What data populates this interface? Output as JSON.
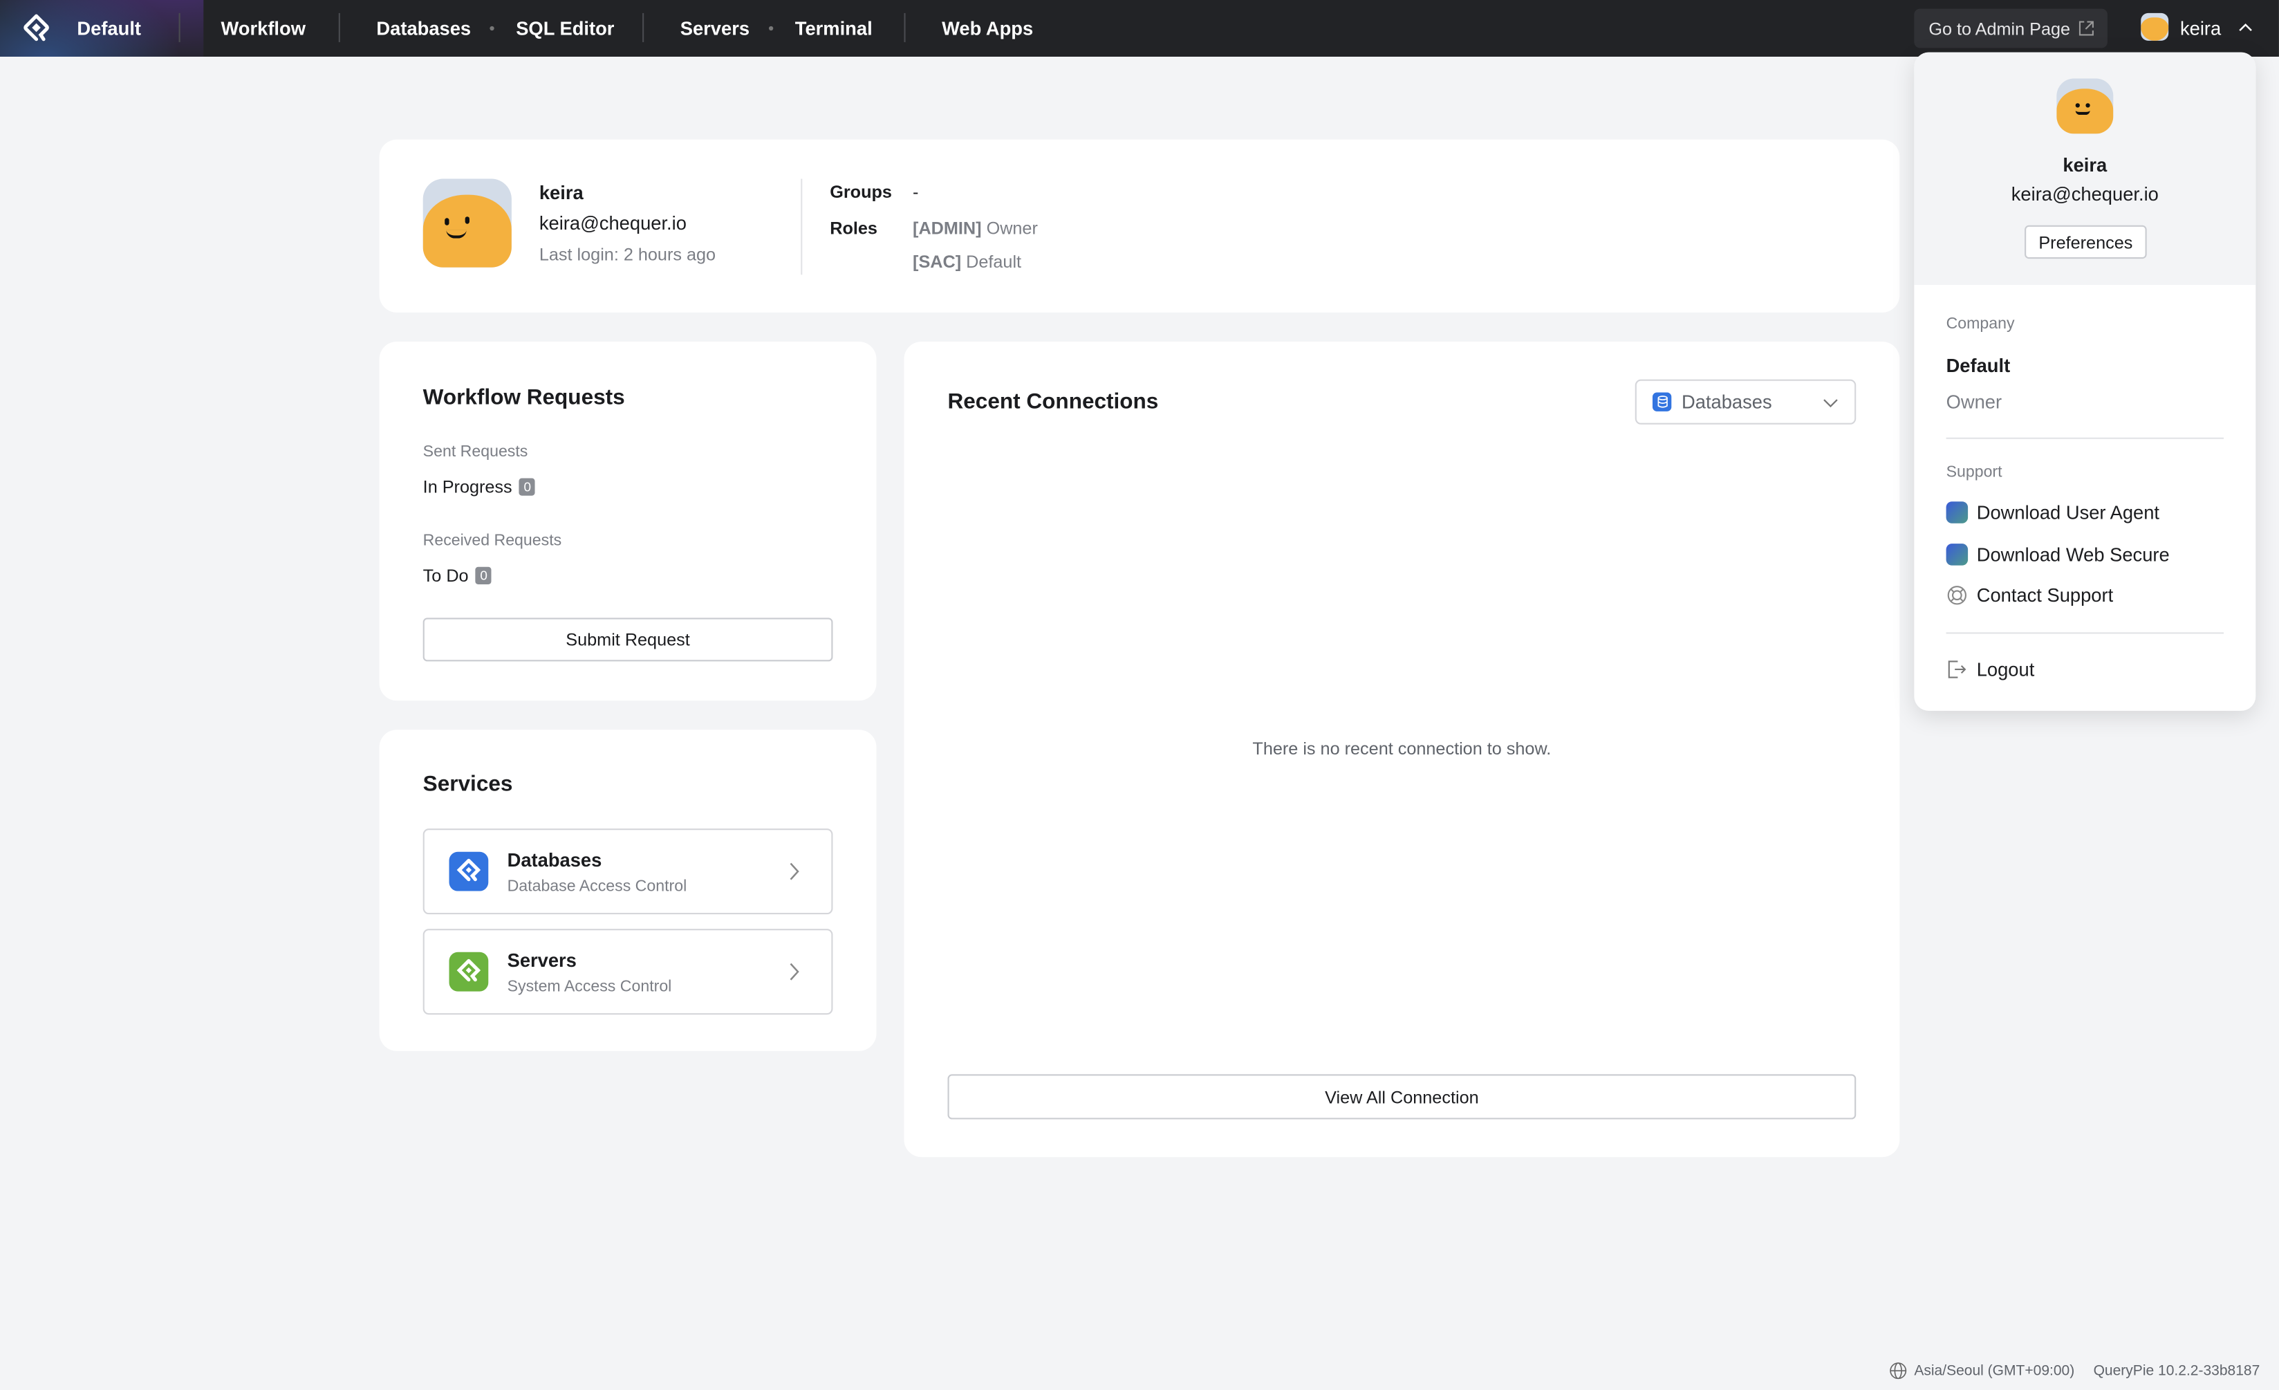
{
  "topbar": {
    "workspace": "Default",
    "nav": [
      "Workflow",
      "Databases",
      "SQL Editor",
      "Servers",
      "Terminal",
      "Web Apps"
    ],
    "admin_button": "Go to Admin Page",
    "user": "keira"
  },
  "profile": {
    "name": "keira",
    "email": "keira@chequer.io",
    "last_login": "Last login: 2 hours ago",
    "groups_label": "Groups",
    "groups_value": "-",
    "roles_label": "Roles",
    "roles": [
      {
        "tag": "[ADMIN]",
        "name": "Owner"
      },
      {
        "tag": "[SAC]",
        "name": "Default"
      }
    ]
  },
  "workflow": {
    "title": "Workflow Requests",
    "sent_label": "Sent Requests",
    "sent_status": "In Progress",
    "sent_count": "0",
    "received_label": "Received Requests",
    "received_status": "To Do",
    "received_count": "0",
    "submit": "Submit Request"
  },
  "services": {
    "title": "Services",
    "items": [
      {
        "name": "Databases",
        "desc": "Database Access Control",
        "color": "#3274e0"
      },
      {
        "name": "Servers",
        "desc": "System Access Control",
        "color": "#6cb33e"
      }
    ]
  },
  "recent": {
    "title": "Recent Connections",
    "filter": "Databases",
    "empty": "There is no recent connection to show.",
    "view_all": "View All Connection"
  },
  "user_menu": {
    "name": "keira",
    "email": "keira@chequer.io",
    "preferences": "Preferences",
    "company_label": "Company",
    "company": "Default",
    "role": "Owner",
    "support_label": "Support",
    "support_items": [
      "Download User Agent",
      "Download Web Secure",
      "Contact Support"
    ],
    "logout": "Logout"
  },
  "footer": {
    "timezone": "Asia/Seoul (GMT+09:00)",
    "version": "QueryPie 10.2.2-33b8187"
  }
}
